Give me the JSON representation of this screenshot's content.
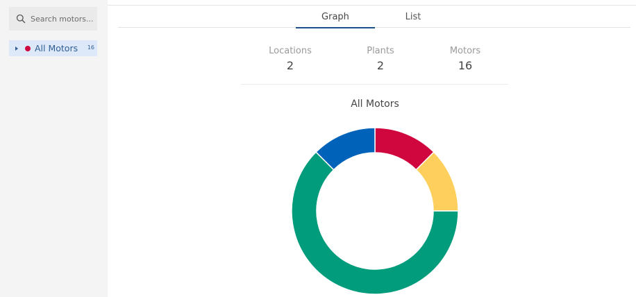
{
  "sidebar": {
    "search": {
      "placeholder": "Search motors..."
    },
    "tree": {
      "label": "All Motors",
      "count": "16",
      "status_color": "#d0063f"
    }
  },
  "tabs": [
    {
      "label": "Graph",
      "active": true
    },
    {
      "label": "List",
      "active": false
    }
  ],
  "stats": {
    "locations": {
      "label": "Locations",
      "value": "2"
    },
    "plants": {
      "label": "Plants",
      "value": "2"
    },
    "motors": {
      "label": "Motors",
      "value": "16"
    }
  },
  "chart_title": "All Motors",
  "chart_data": {
    "type": "pie",
    "title": "All Motors",
    "slices": [
      {
        "value": 2,
        "color": "#d0063f"
      },
      {
        "value": 2,
        "color": "#fecf5d"
      },
      {
        "value": 10,
        "color": "#009c7b"
      },
      {
        "value": 2,
        "color": "#0062b8"
      }
    ]
  }
}
